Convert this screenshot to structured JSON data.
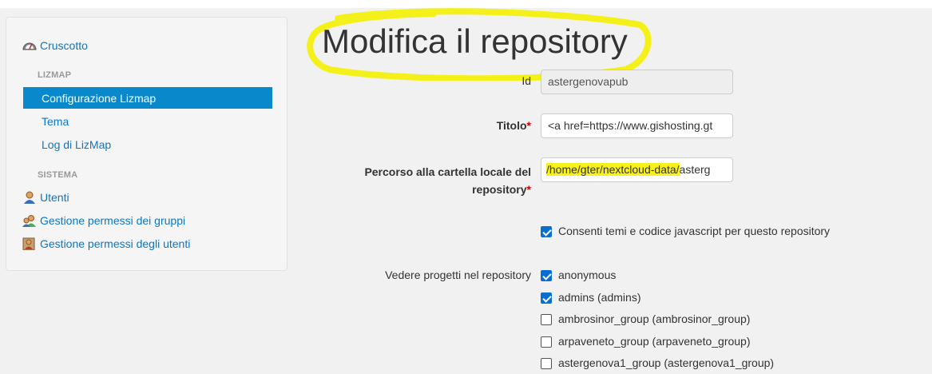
{
  "sidebar": {
    "dashboard": {
      "label": "Cruscotto",
      "icon": "speedometer-icon"
    },
    "sections": [
      {
        "header": "LIZMAP",
        "items": [
          {
            "label": "Configurazione Lizmap",
            "active": true
          },
          {
            "label": "Tema"
          },
          {
            "label": "Log di LizMap"
          }
        ]
      },
      {
        "header": "SISTEMA",
        "items": [
          {
            "label": "Utenti",
            "icon": "user-icon"
          },
          {
            "label": "Gestione permessi dei gruppi",
            "icon": "group-permissions-icon"
          },
          {
            "label": "Gestione permessi degli utenti",
            "icon": "user-permissions-icon"
          }
        ]
      }
    ]
  },
  "page": {
    "title": "Modifica il repository"
  },
  "form": {
    "id": {
      "label": "Id",
      "value": "astergenovapub"
    },
    "title": {
      "label": "Titolo",
      "required_mark": "*",
      "value": "<a href=https://www.gishosting.gt"
    },
    "path": {
      "label_line1": "Percorso alla cartella locale del",
      "label_line2": "repository",
      "required_mark": "*",
      "value_highlighted": "/home/gter/nextcloud-data/",
      "value_rest": "asterg"
    },
    "allow_themes": {
      "label": "Consenti temi e codice javascript per questo repository",
      "checked": true
    },
    "view_projects": {
      "label": "Vedere progetti nel repository",
      "groups": [
        {
          "label": "anonymous",
          "checked": true
        },
        {
          "label": "admins (admins)",
          "checked": true
        },
        {
          "label": "ambrosinor_group (ambrosinor_group)",
          "checked": false
        },
        {
          "label": "arpaveneto_group (arpaveneto_group)",
          "checked": false
        },
        {
          "label": "astergenova1_group (astergenova1_group)",
          "checked": false
        }
      ]
    }
  },
  "colors": {
    "accent": "#0a88cc",
    "link": "#0b76c5",
    "highlight": "#f9f21a",
    "required": "#cc0000"
  }
}
